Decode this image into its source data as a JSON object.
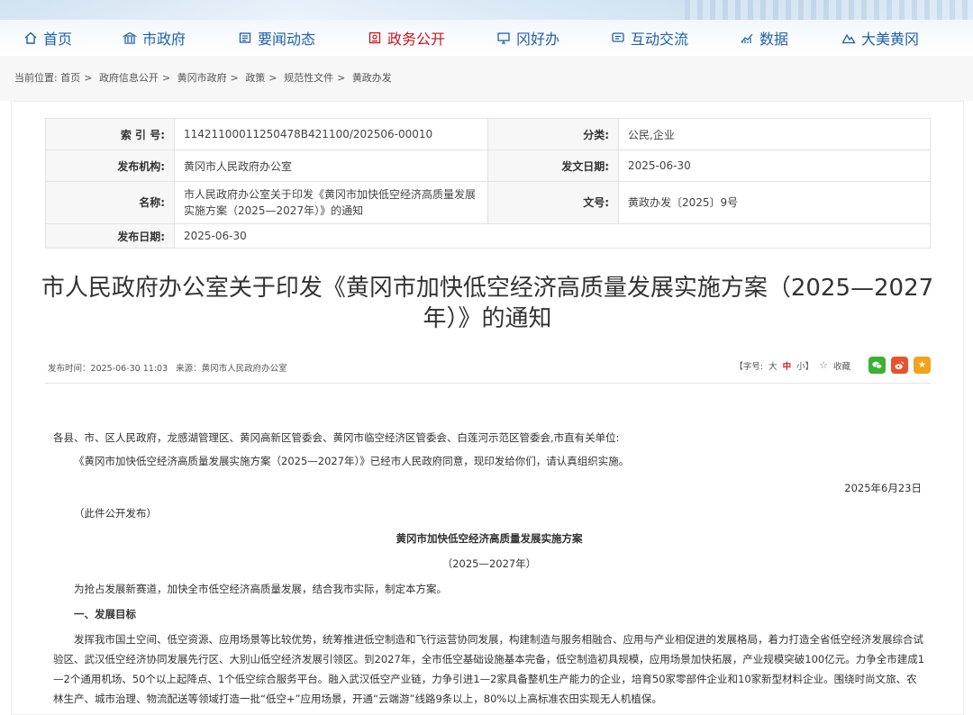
{
  "nav": {
    "items": [
      {
        "label": "首页",
        "icon": "home-icon"
      },
      {
        "label": "市政府",
        "icon": "government-building-icon"
      },
      {
        "label": "要闻动态",
        "icon": "news-icon"
      },
      {
        "label": "政务公开",
        "icon": "public-affairs-icon",
        "active": true
      },
      {
        "label": "冈好办",
        "icon": "monitor-icon"
      },
      {
        "label": "互动交流",
        "icon": "chat-icon"
      },
      {
        "label": "数据",
        "icon": "chart-icon"
      },
      {
        "label": "大美黄冈",
        "icon": "mountain-icon"
      }
    ]
  },
  "breadcrumb": {
    "prefix": "当前位置:",
    "items": [
      "首页",
      "政府信息公开",
      "黄冈市政府",
      "政策",
      "规范性文件",
      "黄政办发"
    ],
    "sep": ">"
  },
  "meta": {
    "index_label": "索 引 号:",
    "index_value": "11421100011250478B421100/202506-00010",
    "category_label": "分类:",
    "category_value": "公民,企业",
    "issuer_label": "发布机构:",
    "issuer_value": "黄冈市人民政府办公室",
    "doc_date_label": "发文日期:",
    "doc_date_value": "2025-06-30",
    "name_label": "名称:",
    "name_value": "市人民政府办公室关于印发《黄冈市加快低空经济高质量发展实施方案（2025—2027年）》的通知",
    "doc_no_label": "文号:",
    "doc_no_value": "黄政办发〔2025〕9号",
    "publish_label": "发布日期:",
    "publish_value": "2025-06-30"
  },
  "article": {
    "title": "市人民政府办公室关于印发《黄冈市加快低空经济高质量发展实施方案（2025—2027年）》的通知",
    "publish_time": "发布时间：2025-06-30 11:03",
    "source": "来源：黄冈市人民政府办公室",
    "font_size_label": "【字号:",
    "size_large": "大",
    "size_mid": "中",
    "size_small": "小】",
    "collect_label": "收藏",
    "body": {
      "addressee": "各县、市、区人民政府，龙感湖管理区、黄冈高新区管委会、黄冈市临空经济区管委会、白莲河示范区管委会,市直有关单位:",
      "p1": "《黄冈市加快低空经济高质量发展实施方案（2025—2027年）》已经市人民政府同意，现印发给你们，请认真组织实施。",
      "date": "2025年6月23日",
      "public_note": "（此件公开发布）",
      "plan_title": "黄冈市加快低空经济高质量发展实施方案",
      "plan_years": "（2025—2027年）",
      "p2": "为抢占发展新赛道，加快全市低空经济高质量发展，结合我市实际，制定本方案。",
      "section1": "一、发展目标",
      "p3": "发挥我市国土空间、低空资源、应用场景等比较优势，统筹推进低空制造和飞行运营协同发展，构建制造与服务相融合、应用与产业相促进的发展格局，着力打造全省低空经济发展综合试验区、武汉低空经济协同发展先行区、大别山低空经济发展引领区。到2027年，全市低空基础设施基本完备，低空制造初具规模，应用场景加快拓展，产业规模突破100亿元。力争全市建成1—2个通用机场、50个以上起降点、1个低空综合服务平台。融入武汉低空产业链，力争引进1—2家具备整机生产能力的企业，培育50家零部件企业和10家新型材料企业。围绕时尚文旅、农林生产、城市治理、物流配送等领域打造一批“低空+”应用场景，开通“云端游”线路9条以上，80%以上高标准农田实现无人机植保。"
    }
  }
}
